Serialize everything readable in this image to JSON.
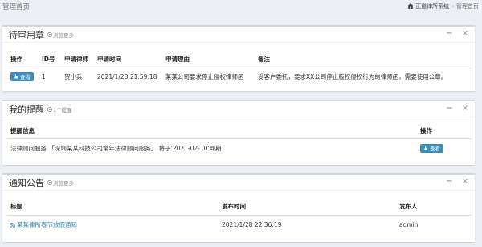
{
  "topbar": {
    "page_title": "管理首页",
    "breadcrumb": [
      "正道律所系统",
      "管理首页"
    ]
  },
  "seal_panel": {
    "title": "待审用章",
    "more": "浏览更多",
    "columns": [
      "操作",
      "ID号",
      "申请律师",
      "申请时间",
      "申请理由",
      "备注"
    ],
    "rows": [
      {
        "action": "查看",
        "id": "1",
        "lawyer": "贺小兵",
        "time": "2021/1/28 21:59:18",
        "reason": "某某公司要求停止侵权律师函",
        "note": "受客户委托，要求XX公司停止版权侵权行为的律师函，需要使用公章。"
      }
    ]
  },
  "reminder_panel": {
    "title": "我的提醒",
    "count": "1个提醒",
    "columns": [
      "提醒信息",
      "操作"
    ],
    "rows": [
      {
        "message": "法律顾问服务 「深圳某某科技公司常年法律顾问服务」 将于'2021-02-10'到期",
        "action": "查看"
      }
    ]
  },
  "notice_panel": {
    "title": "通知公告",
    "more": "浏览更多",
    "columns": [
      "标题",
      "发布时间",
      "发布人"
    ],
    "rows": [
      {
        "title": "某某律所春节放假通知",
        "time": "2021/1/28 22:36:19",
        "publisher": "admin"
      }
    ]
  },
  "tools": {
    "minimize": "−",
    "close": "×"
  },
  "colors": {
    "accent": "#3c8dbc",
    "background": "#ecf0f5",
    "panel_border": "#d2d6de"
  }
}
